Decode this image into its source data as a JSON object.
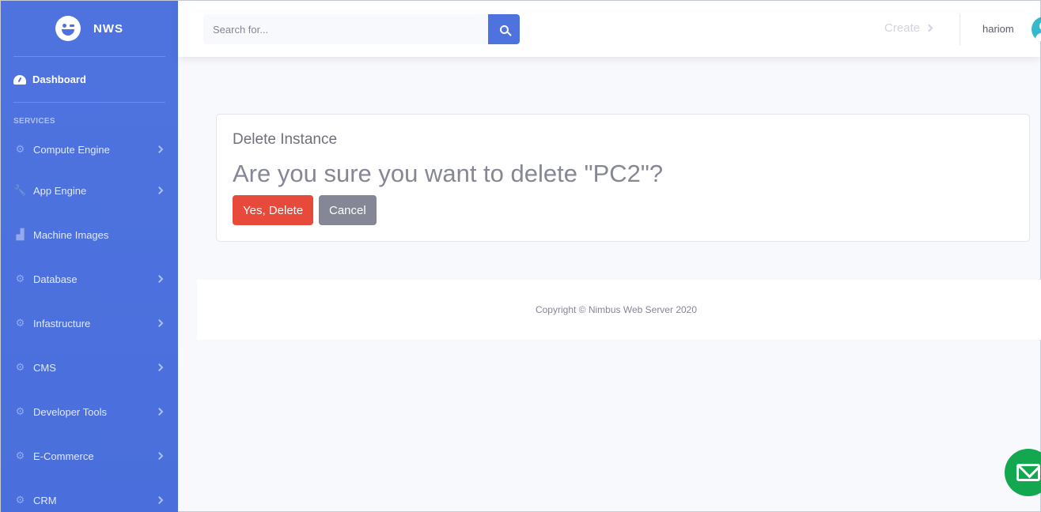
{
  "sidebar": {
    "brand": "NWS",
    "dashboard": "Dashboard",
    "section_heading": "SERVICES",
    "items": [
      {
        "label": "Compute Engine",
        "icon": "gear-icon",
        "has_children": true
      },
      {
        "label": "App Engine",
        "icon": "wrench-icon",
        "has_children": true
      },
      {
        "label": "Machine Images",
        "icon": "chart-area-icon",
        "has_children": false
      },
      {
        "label": "Database",
        "icon": "gear-icon",
        "has_children": true
      },
      {
        "label": "Infastructure",
        "icon": "gear-icon",
        "has_children": true
      },
      {
        "label": "CMS",
        "icon": "gear-icon",
        "has_children": true
      },
      {
        "label": "Developer Tools",
        "icon": "gear-icon",
        "has_children": true
      },
      {
        "label": "E-Commerce",
        "icon": "gear-icon",
        "has_children": true
      },
      {
        "label": "CRM",
        "icon": "gear-icon",
        "has_children": true
      }
    ]
  },
  "topbar": {
    "search_placeholder": "Search for...",
    "create_label": "Create",
    "username": "hariom"
  },
  "card": {
    "title": "Delete Instance",
    "question": "Are you sure you want to delete \"PC2\"?",
    "confirm_label": "Yes, Delete",
    "cancel_label": "Cancel"
  },
  "footer": {
    "copyright": "Copyright © Nimbus Web Server 2020"
  },
  "colors": {
    "primary": "#4e73df",
    "danger": "#e74a3b",
    "secondary": "#858796",
    "success": "#13a850"
  }
}
